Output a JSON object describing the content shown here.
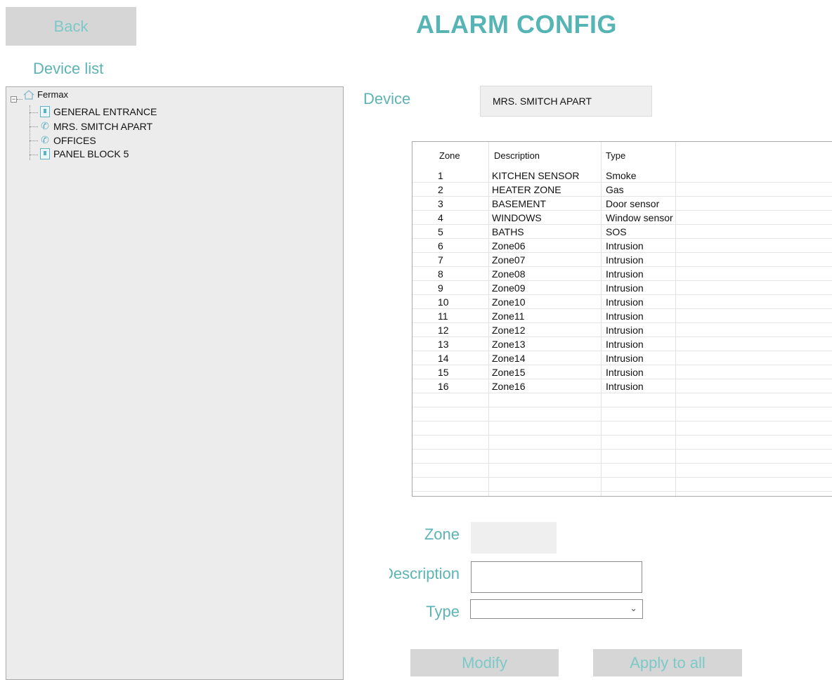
{
  "header": {
    "back_label": "Back",
    "title": "ALARM CONFIG"
  },
  "sidebar": {
    "label": "Device list",
    "root": "Fermax",
    "items": [
      {
        "label": "GENERAL ENTRANCE",
        "icon": "panel-icon"
      },
      {
        "label": "MRS. SMITCH APART",
        "icon": "phone-icon"
      },
      {
        "label": "OFFICES",
        "icon": "phone-icon"
      },
      {
        "label": "PANEL BLOCK 5",
        "icon": "panel-icon"
      }
    ]
  },
  "device": {
    "label": "Device",
    "value": "MRS. SMITCH APART"
  },
  "table": {
    "headers": {
      "zone": "Zone",
      "description": "Description",
      "type": "Type"
    },
    "rows": [
      {
        "zone": "1",
        "description": "KITCHEN SENSOR",
        "type": "Smoke"
      },
      {
        "zone": "2",
        "description": "HEATER ZONE",
        "type": "Gas"
      },
      {
        "zone": "3",
        "description": "BASEMENT",
        "type": "Door sensor"
      },
      {
        "zone": "4",
        "description": "WINDOWS",
        "type": "Window sensor"
      },
      {
        "zone": "5",
        "description": "BATHS",
        "type": "SOS"
      },
      {
        "zone": "6",
        "description": "Zone06",
        "type": "Intrusion"
      },
      {
        "zone": "7",
        "description": "Zone07",
        "type": "Intrusion"
      },
      {
        "zone": "8",
        "description": "Zone08",
        "type": "Intrusion"
      },
      {
        "zone": "9",
        "description": "Zone09",
        "type": "Intrusion"
      },
      {
        "zone": "10",
        "description": "Zone10",
        "type": "Intrusion"
      },
      {
        "zone": "11",
        "description": "Zone11",
        "type": "Intrusion"
      },
      {
        "zone": "12",
        "description": "Zone12",
        "type": "Intrusion"
      },
      {
        "zone": "13",
        "description": "Zone13",
        "type": "Intrusion"
      },
      {
        "zone": "14",
        "description": "Zone14",
        "type": "Intrusion"
      },
      {
        "zone": "15",
        "description": "Zone15",
        "type": "Intrusion"
      },
      {
        "zone": "16",
        "description": "Zone16",
        "type": "Intrusion"
      }
    ]
  },
  "form": {
    "zone_label": "Zone",
    "description_label": "Description",
    "type_label": "Type",
    "zone_value": "",
    "description_value": "",
    "type_value": ""
  },
  "actions": {
    "modify_label": "Modify",
    "apply_all_label": "Apply to all"
  },
  "colors": {
    "accent": "#5eb3b4",
    "button_bg": "#d6d6d6",
    "button_text": "#7cc9c8"
  }
}
